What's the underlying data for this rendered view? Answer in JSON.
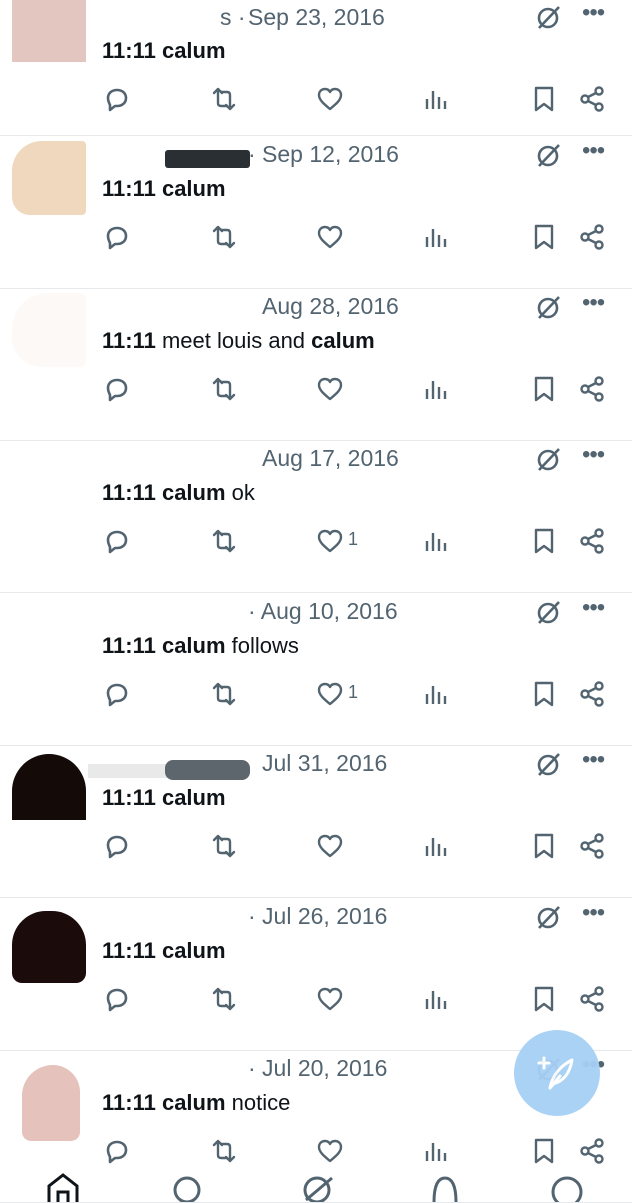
{
  "tweets": [
    {
      "handle_fragment": "s ·",
      "date": "Sep 23, 2016",
      "text_bold": "11:11 calum",
      "text_rest": "",
      "like_count": ""
    },
    {
      "handle_fragment": "",
      "date": "· Sep 12, 2016",
      "text_bold": "11:11 calum",
      "text_rest": "",
      "like_count": ""
    },
    {
      "handle_fragment": "",
      "date": "Aug 28, 2016",
      "text_bold": "11:11",
      "text_mid": " meet louis and ",
      "text_bold2": "calum",
      "text_rest": "",
      "like_count": ""
    },
    {
      "handle_fragment": "",
      "date": "Aug 17, 2016",
      "text_bold": "11:11 calum",
      "text_rest": " ok",
      "like_count": "1"
    },
    {
      "handle_fragment": "",
      "date": "· Aug 10, 2016",
      "text_bold": "11:11 calum",
      "text_rest": " follows",
      "like_count": "1"
    },
    {
      "handle_fragment": "",
      "date": "Jul 31, 2016",
      "text_bold": "11:11 calum",
      "text_rest": "",
      "like_count": ""
    },
    {
      "handle_fragment": "",
      "date": "· Jul 26, 2016",
      "text_bold": "11:11 calum",
      "text_rest": "",
      "like_count": ""
    },
    {
      "handle_fragment": "",
      "date": "· Jul 20, 2016",
      "text_bold": "11:11 calum",
      "text_rest": " notice",
      "like_count": ""
    }
  ],
  "icons": {
    "reply": "reply-icon",
    "retweet": "retweet-icon",
    "like": "heart-icon",
    "views": "views-icon",
    "bookmark": "bookmark-icon",
    "share": "share-icon",
    "grok": "grok-icon",
    "more": "more-icon",
    "compose": "compose-icon"
  },
  "colors": {
    "text": "#0f1419",
    "secondary": "#536471",
    "divider": "#e6e9ec",
    "fab": "#a6d0f5"
  }
}
